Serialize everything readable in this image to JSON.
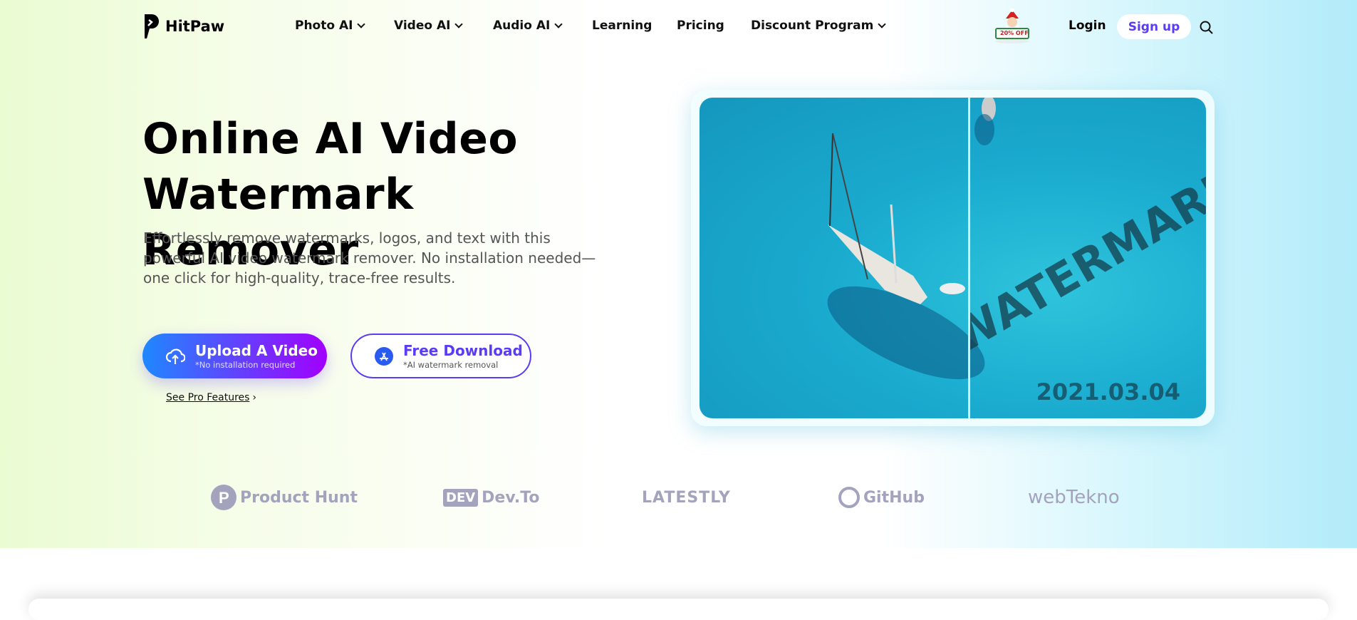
{
  "brand": {
    "name": "HitPaw"
  },
  "nav": {
    "items": [
      {
        "label": "Photo AI",
        "dropdown": true
      },
      {
        "label": "Video AI",
        "dropdown": true
      },
      {
        "label": "Audio AI",
        "dropdown": true
      },
      {
        "label": "Learning",
        "dropdown": false
      },
      {
        "label": "Pricing",
        "dropdown": false
      },
      {
        "label": "Discount Program",
        "dropdown": true
      }
    ],
    "promo_badge": "20% OFF",
    "login": "Login",
    "signup": "Sign up"
  },
  "hero": {
    "title_line1": "Online AI Video",
    "title_line2": "Watermark Remover",
    "description": "Effortlessly remove watermarks, logos, and text with this powerful AI video watermark remover. No installation needed—one click for high-quality, trace-free results.",
    "upload": {
      "label": "Upload A Video",
      "sub": "*No installation required"
    },
    "download": {
      "label": "Free Download",
      "sub": "*AI watermark removal"
    },
    "pro_link": "See Pro Features",
    "preview": {
      "watermark_text": "WATERMARK",
      "date_stamp": "2021.03.04"
    }
  },
  "partners": [
    "Product Hunt",
    "Dev.To",
    "LATESTLY",
    "GitHub",
    "webTekno"
  ],
  "colors": {
    "accent": "#5a3cf5",
    "gradient_start": "#1f88ff",
    "gradient_end": "#a100ff"
  }
}
